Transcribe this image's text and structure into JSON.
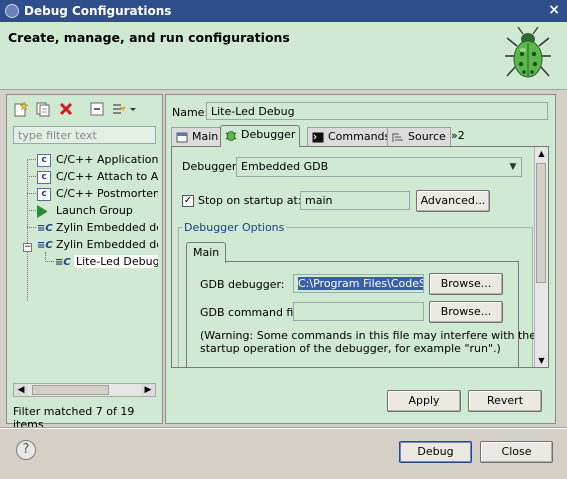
{
  "window": {
    "title": "Debug Configurations",
    "close_glyph": "×"
  },
  "banner": {
    "heading": "Create, manage, and run configurations",
    "icon": "debug-bug-icon"
  },
  "left": {
    "filter_placeholder": "type filter text",
    "tree": [
      {
        "label": "C/C++ Application",
        "icon": "c-icon"
      },
      {
        "label": "C/C++ Attach to Application",
        "icon": "c-icon"
      },
      {
        "label": "C/C++ Postmortem Debugger",
        "icon": "c-icon"
      },
      {
        "label": "Launch Group",
        "icon": "launch-group-icon"
      },
      {
        "label": "Zylin Embedded debug (Cygwin)",
        "icon": "zylin-icon"
      },
      {
        "label": "Zylin Embedded debug (Native)",
        "icon": "zylin-icon",
        "expanded": true
      },
      {
        "label": "Lite-Led Debug",
        "icon": "zylin-icon",
        "selected": true
      }
    ],
    "status": "Filter matched 7 of 19 items"
  },
  "right": {
    "name_label": "Name:",
    "name_value": "Lite-Led Debug",
    "tabs": [
      {
        "label": "Main",
        "icon": "main-tab-icon"
      },
      {
        "label": "Debugger",
        "icon": "debugger-tab-icon",
        "active": true
      },
      {
        "label": "Commands",
        "icon": "commands-tab-icon"
      },
      {
        "label": "Source",
        "icon": "source-tab-icon"
      },
      {
        "label": "»2",
        "icon": ""
      }
    ],
    "debugger_label": "Debugger:",
    "debugger_value": "Embedded GDB",
    "stop_label": "Stop on startup at:",
    "stop_checked": "✓",
    "stop_value": "main",
    "advanced_label": "Advanced...",
    "options_title": "Debugger Options",
    "options_tab": "Main",
    "gdb_debugger_label": "GDB debugger:",
    "gdb_debugger_value": "C:\\Program Files\\CodeSourcery",
    "browse_label": "Browse...",
    "gdb_command_label": "GDB command file:",
    "gdb_command_value": "",
    "warning_line1": "(Warning: Some commands in this file may interfere with the",
    "warning_line2": "startup operation of the debugger, for example \"run\".)",
    "apply_label": "Apply",
    "revert_label": "Revert"
  },
  "footer": {
    "help_glyph": "?",
    "debug_label": "Debug",
    "close_label": "Close"
  }
}
